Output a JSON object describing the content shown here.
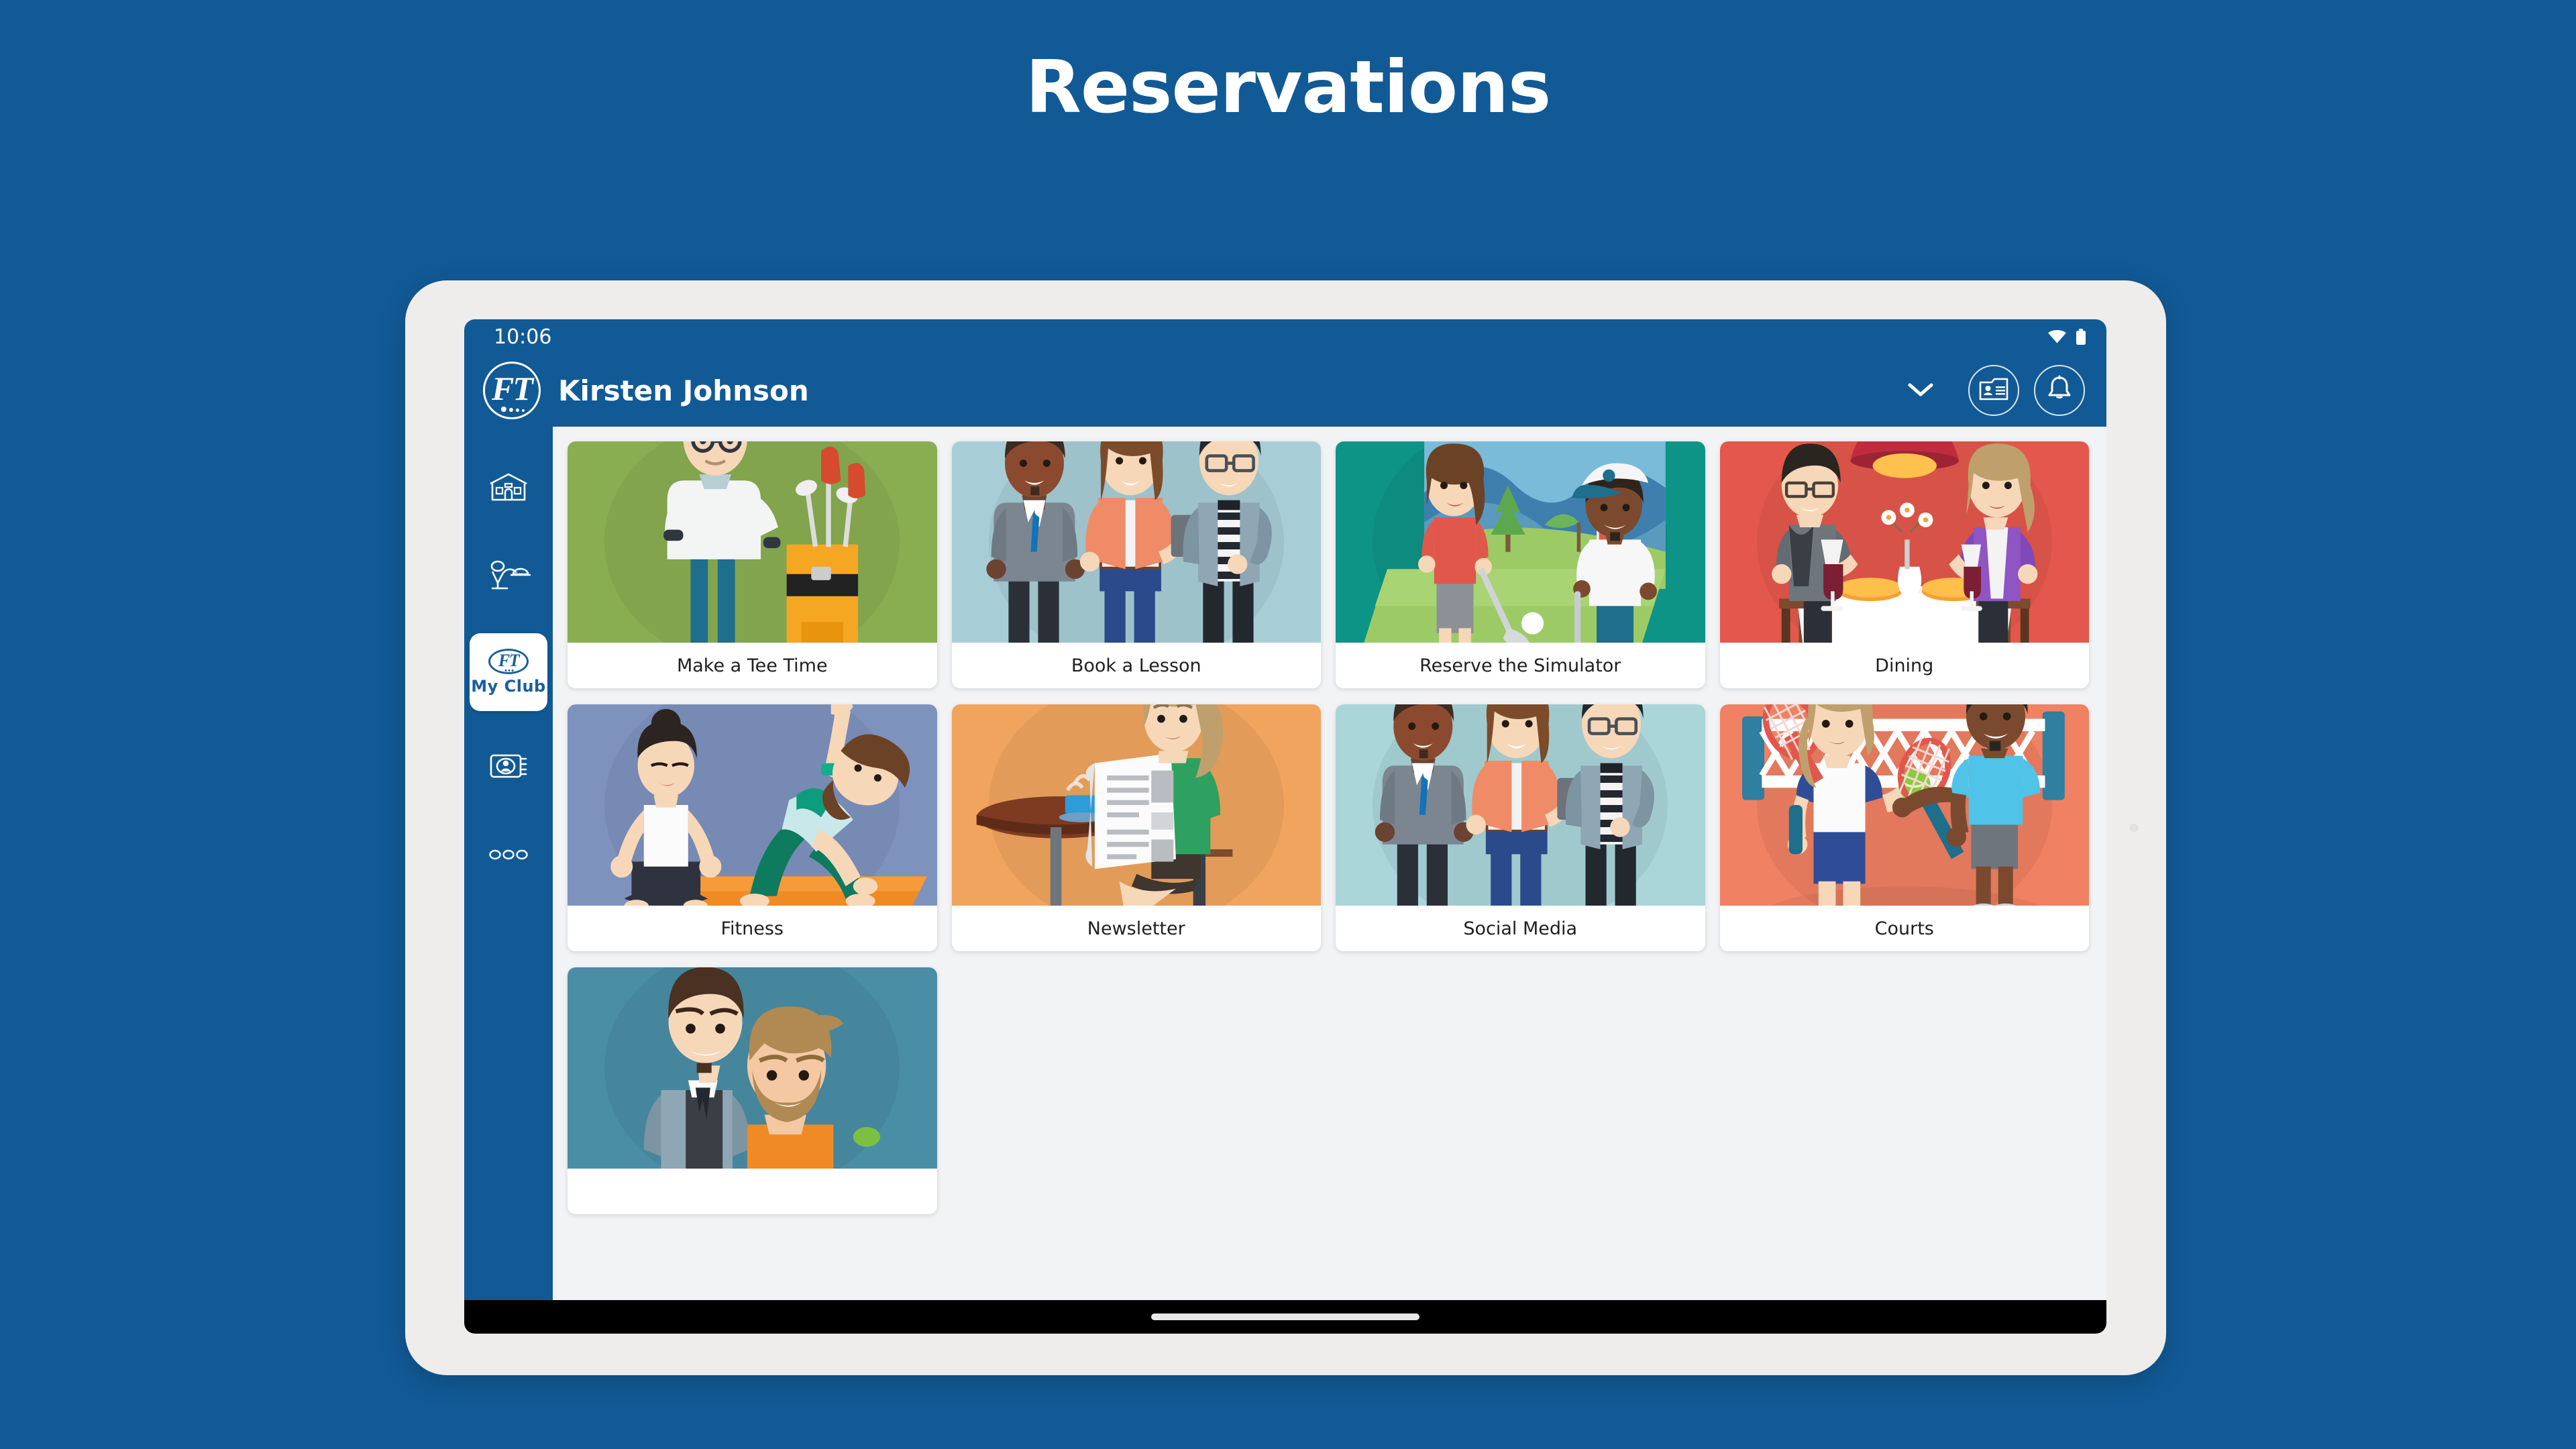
{
  "page": {
    "title": "Reservations",
    "background_color": "#115A96"
  },
  "device": {
    "bezel_color": "#eeedeb",
    "screen_background": "#f2f3f4"
  },
  "statusbar": {
    "time": "10:06",
    "wifi_icon": "wifi-icon",
    "battery_icon": "battery-icon"
  },
  "appbar": {
    "logo_text": "FT",
    "user_name": "Kirsten Johnson",
    "chevron_icon": "chevron-down-icon",
    "membership_card_icon": "membership-card-icon",
    "notifications_icon": "bell-icon",
    "background_color": "#115A96"
  },
  "sidebar": {
    "background_color": "#115A96",
    "items": [
      {
        "icon": "clubhouse-icon",
        "label": "",
        "active": false
      },
      {
        "icon": "waiter-service-icon",
        "label": "",
        "active": false
      },
      {
        "icon": "my-club-logo-icon",
        "label": "My Club",
        "active": true
      },
      {
        "icon": "member-directory-icon",
        "label": "",
        "active": false
      },
      {
        "icon": "more-options-icon",
        "label": "",
        "active": false
      }
    ]
  },
  "content": {
    "cards": [
      {
        "label": "Make a Tee Time",
        "art": "golfer-with-bag",
        "bg": "#89AE52"
      },
      {
        "label": "Book a Lesson",
        "art": "three-people-phone",
        "bg": "#A7CED6"
      },
      {
        "label": "Reserve the Simulator",
        "art": "golf-simulator",
        "bg": "#0E9487"
      },
      {
        "label": "Dining",
        "art": "couple-dining",
        "bg": "#E4574C"
      },
      {
        "label": "Fitness",
        "art": "yoga-women",
        "bg": "#7E92BE"
      },
      {
        "label": "Newsletter",
        "art": "woman-reading-paper",
        "bg": "#F0A45E"
      },
      {
        "label": "Social Media",
        "art": "three-people-phone",
        "bg": "#AAD5D9"
      },
      {
        "label": "Courts",
        "art": "tennis-players",
        "bg": "#F08163"
      },
      {
        "label": "",
        "art": "waiter-and-guest",
        "bg": "#4A8EA6"
      }
    ]
  },
  "navigation": {
    "home_indicator": "home-indicator"
  }
}
